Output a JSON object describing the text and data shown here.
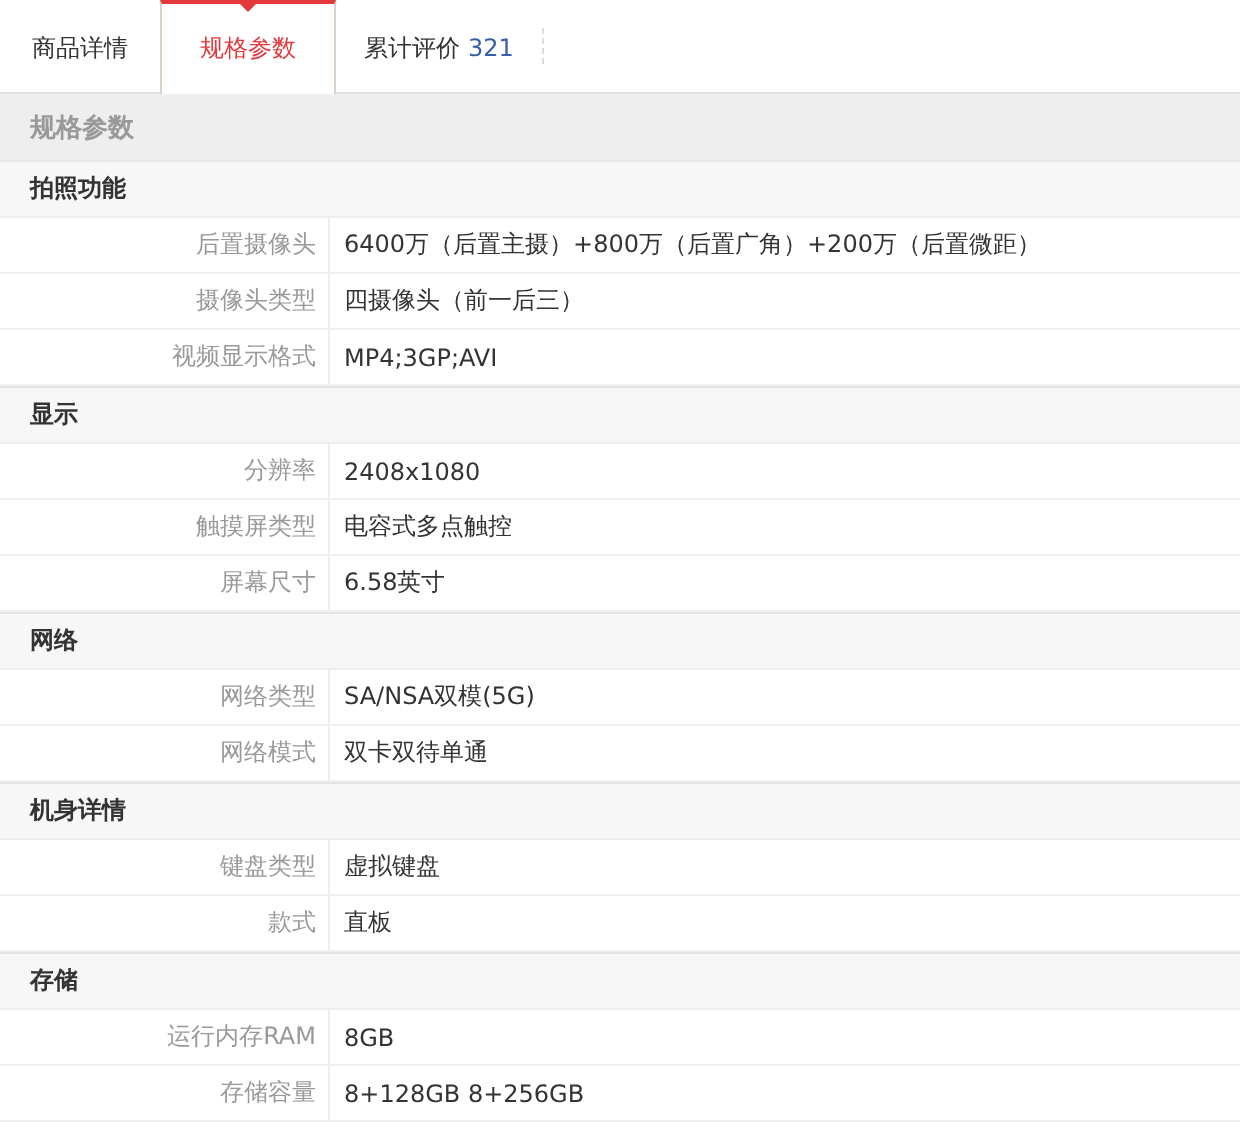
{
  "tabs": [
    {
      "label": "商品详情",
      "selected": false
    },
    {
      "label": "规格参数",
      "selected": true
    },
    {
      "label": "累计评价",
      "count": "321",
      "selected": false
    }
  ],
  "section_title": "规格参数",
  "groups": [
    {
      "title": "拍照功能",
      "rows": [
        {
          "label": "后置摄像头",
          "value": "6400万（后置主摄）+800万（后置广角）+200万（后置微距）"
        },
        {
          "label": "摄像头类型",
          "value": "四摄像头（前一后三）"
        },
        {
          "label": "视频显示格式",
          "value": "MP4;3GP;AVI"
        }
      ]
    },
    {
      "title": "显示",
      "rows": [
        {
          "label": "分辨率",
          "value": "2408x1080"
        },
        {
          "label": "触摸屏类型",
          "value": "电容式多点触控"
        },
        {
          "label": "屏幕尺寸",
          "value": "6.58英寸"
        }
      ]
    },
    {
      "title": "网络",
      "rows": [
        {
          "label": "网络类型",
          "value": "SA/NSA双模(5G)"
        },
        {
          "label": "网络模式",
          "value": "双卡双待单通"
        }
      ]
    },
    {
      "title": "机身详情",
      "rows": [
        {
          "label": "键盘类型",
          "value": "虚拟键盘"
        },
        {
          "label": "款式",
          "value": "直板"
        }
      ]
    },
    {
      "title": "存储",
      "rows": [
        {
          "label": "运行内存RAM",
          "value": "8GB"
        },
        {
          "label": "存储容量",
          "value": "8+128GB 8+256GB"
        }
      ]
    }
  ]
}
